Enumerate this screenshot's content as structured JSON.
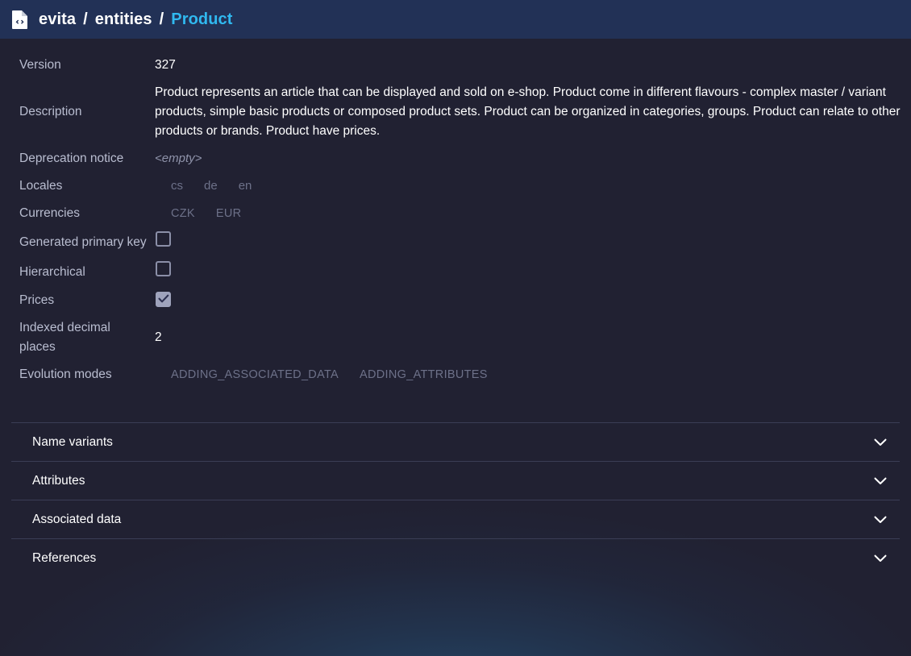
{
  "header": {
    "icon": "file-code-icon",
    "breadcrumb": [
      {
        "label": "evita",
        "accent": false
      },
      {
        "label": "entities",
        "accent": false
      },
      {
        "label": "Product",
        "accent": true
      }
    ],
    "separator": "/",
    "bg_color": "#223156",
    "accent_color": "#30b9f0"
  },
  "properties": {
    "version": {
      "label": "Version",
      "value": "327"
    },
    "description": {
      "label": "Description",
      "value": "Product represents an article that can be displayed and sold on e-shop. Product come in different flavours - complex master / variant products, simple basic products or composed product sets. Product can be organized in categories, groups. Product can relate to other products or brands. Product have prices."
    },
    "deprecation_notice": {
      "label": "Deprecation notice",
      "value": "<empty>"
    },
    "locales": {
      "label": "Locales",
      "values": [
        "cs",
        "de",
        "en"
      ]
    },
    "currencies": {
      "label": "Currencies",
      "values": [
        "CZK",
        "EUR"
      ]
    },
    "generated_primary_key": {
      "label": "Generated primary key",
      "checked": false
    },
    "hierarchical": {
      "label": "Hierarchical",
      "checked": false
    },
    "prices": {
      "label": "Prices",
      "checked": true
    },
    "indexed_decimal_places": {
      "label": "Indexed decimal places",
      "value": "2"
    },
    "evolution_modes": {
      "label": "Evolution modes",
      "values": [
        "ADDING_ASSOCIATED_DATA",
        "ADDING_ATTRIBUTES"
      ]
    }
  },
  "panels": [
    {
      "title": "Name variants",
      "expanded": false,
      "chevron": "chevron-down-icon"
    },
    {
      "title": "Attributes",
      "expanded": false,
      "chevron": "chevron-down-icon"
    },
    {
      "title": "Associated data",
      "expanded": false,
      "chevron": "chevron-down-icon"
    },
    {
      "title": "References",
      "expanded": false,
      "chevron": "chevron-down-icon"
    }
  ],
  "theme": {
    "background": "#212132",
    "label_color": "#b9bdd0",
    "value_color": "#ffffff",
    "muted_color": "#6d7189",
    "divider_color": "#3a3d55",
    "glow_color": "#2a6a9e"
  }
}
